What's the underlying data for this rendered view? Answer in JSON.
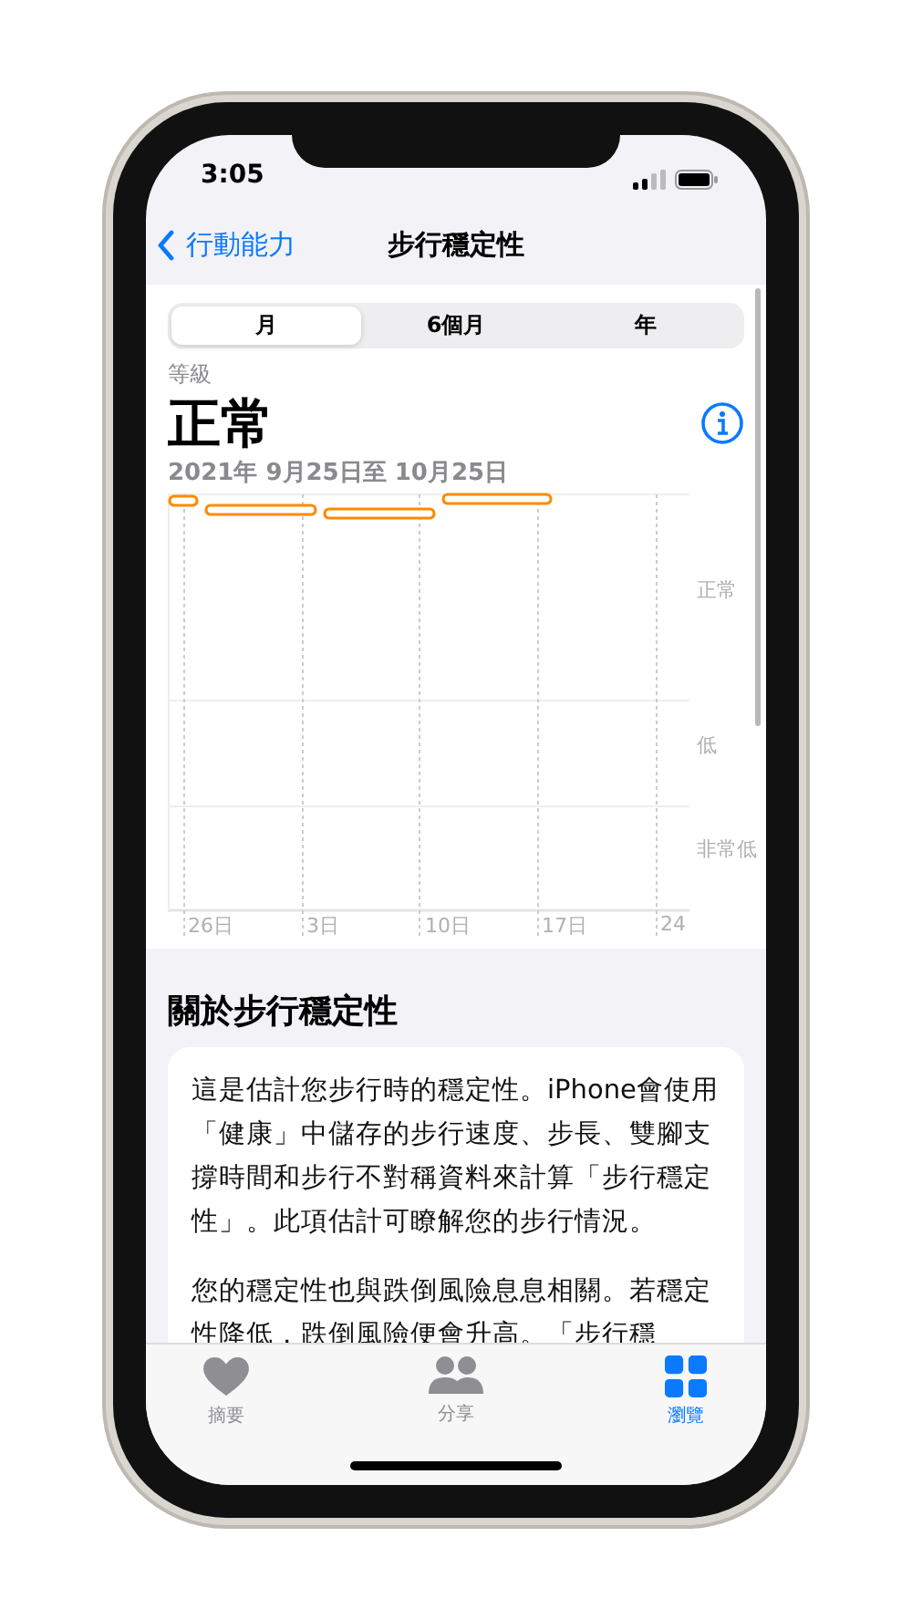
{
  "status_bar": {
    "time": "3:05"
  },
  "nav": {
    "back": "行動能力",
    "title": "步行穩定性"
  },
  "segments": [
    {
      "label": "月",
      "selected": true
    },
    {
      "label": "6個月",
      "selected": false
    },
    {
      "label": "年",
      "selected": false
    }
  ],
  "summary": {
    "caption": "等級",
    "value": "正常",
    "range": "2021年 9月25日至 10月25日"
  },
  "chart": {
    "y_labels": [
      "正常",
      "低",
      "非常低"
    ],
    "x_labels": [
      "26日",
      "3日",
      "10日",
      "17日",
      "24"
    ]
  },
  "about": {
    "heading": "關於步行穩定性",
    "paragraphs": [
      "這是估計您步行時的穩定性。iPhone會使用「健康」中儲存的步行速度、步長、雙腳支撐時間和步行不對稱資料來計算「步行穩定性」。此項估計可瞭解您的步行情況。",
      "您的穩定性也與跌倒風險息息相關。若穩定性降低，跌倒風險便會升高。「步行穩"
    ]
  },
  "tab_bar": [
    {
      "label": "摘要",
      "kind": "heart",
      "selected": false
    },
    {
      "label": "分享",
      "kind": "people",
      "selected": false
    },
    {
      "label": "瀏覽",
      "kind": "grid",
      "selected": true
    }
  ]
}
